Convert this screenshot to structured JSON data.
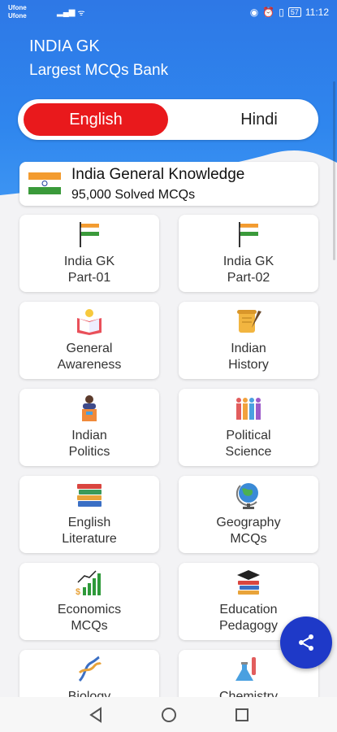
{
  "status_bar": {
    "carrier1": "Ufone",
    "carrier2": "Ufone",
    "battery": "57",
    "time": "11:12"
  },
  "header": {
    "title": "INDIA GK",
    "subtitle": "Largest MCQs Bank",
    "background_color": "#2f86ee"
  },
  "language_toggle": {
    "english_label": "English",
    "hindi_label": "Hindi",
    "selected": "English",
    "active_color": "#e9191c"
  },
  "info_card": {
    "title": "India General Knowledge",
    "subtitle": "95,000 Solved MCQs",
    "icon": "india-flag-icon"
  },
  "categories": [
    {
      "line1": "India GK",
      "line2": "Part-01",
      "icon": "flag-on-pole-icon"
    },
    {
      "line1": "India GK",
      "line2": "Part-02",
      "icon": "flag-on-pole-icon"
    },
    {
      "line1": "General",
      "line2": "Awareness",
      "icon": "book-bulb-icon"
    },
    {
      "line1": "Indian",
      "line2": "History",
      "icon": "scroll-quill-icon"
    },
    {
      "line1": "Indian",
      "line2": "Politics",
      "icon": "speaker-podium-icon"
    },
    {
      "line1": "Political",
      "line2": "Science",
      "icon": "people-group-icon"
    },
    {
      "line1": "English",
      "line2": "Literature",
      "icon": "book-stack-icon"
    },
    {
      "line1": "Geography",
      "line2": "MCQs",
      "icon": "globe-icon"
    },
    {
      "line1": "Economics",
      "line2": "MCQs",
      "icon": "growth-chart-icon"
    },
    {
      "line1": "Education",
      "line2": "Pedagogy",
      "icon": "books-grad-cap-icon"
    },
    {
      "line1": "Biology",
      "line2": "",
      "icon": "dna-icon"
    },
    {
      "line1": "Chemistry",
      "line2": "",
      "icon": "flask-icon"
    }
  ],
  "fab": {
    "icon": "share-icon",
    "color": "#1e39c8"
  },
  "nav": {
    "back": "back-icon",
    "home": "home-icon",
    "recents": "recents-icon"
  }
}
